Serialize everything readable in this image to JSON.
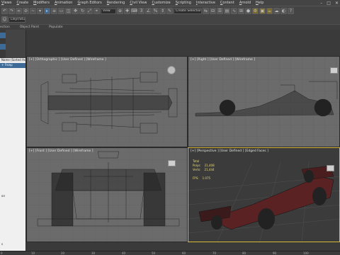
{
  "menubar": {
    "items": [
      "Views",
      "Create",
      "Modifiers",
      "Animation",
      "Graph Editors",
      "Rendering",
      "Civil View",
      "Customize",
      "Scripting",
      "Interactive",
      "Content",
      "Arnold",
      "Help"
    ]
  },
  "toolbar": {
    "view_combo": "View",
    "selection_set_combo": "Create Selection Se",
    "user_combo": "Lleyr/Stud"
  },
  "ribbon": {
    "items": [
      "ection",
      "Object Paint",
      "Populate"
    ]
  },
  "scene_explorer": {
    "header": "Name (Sorted Ascending)",
    "rows": [
      "+ Fronp",
      "on",
      "s"
    ]
  },
  "viewports": {
    "top": "[+] [Orthographic ] [User Defined ] [Wireframe ]",
    "right": "[+] [Right ] [User Defined ] [Wireframe ]",
    "front": "[+] [Front ] [User Defined ] [Wireframe ]",
    "perspective": "[+] [Perspective ] [User Defined ] [Edged Faces ]"
  },
  "stats": {
    "title": "Total",
    "polys_label": "Polys:",
    "polys_value": "21,408",
    "verts_label": "Verts:",
    "verts_value": "21,444",
    "fps_label": "FPS:",
    "fps_value": "1.075"
  },
  "timeline": {
    "ticks": [
      "0",
      "10",
      "20",
      "30",
      "40",
      "50",
      "60",
      "70",
      "80",
      "90",
      "100"
    ]
  },
  "colors": {
    "active_viewport_border": "#d8b73a",
    "car_body": "#5a2222",
    "accent_blue": "#3d6a96"
  }
}
